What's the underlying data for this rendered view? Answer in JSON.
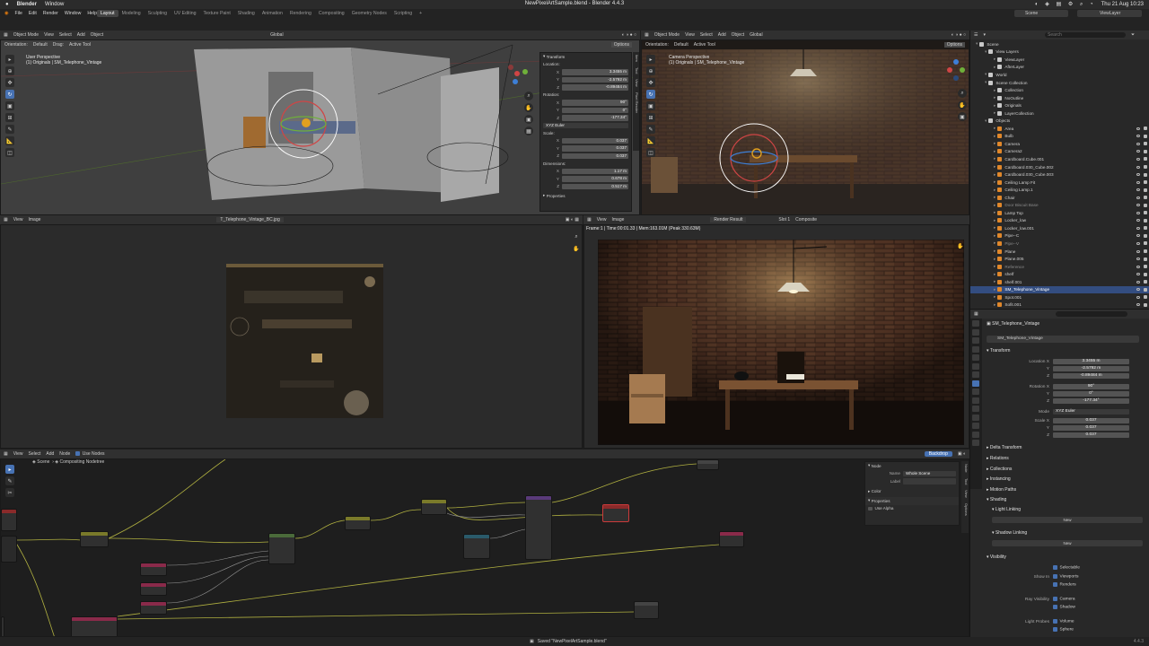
{
  "macbar": {
    "apple": "",
    "app": "Blender",
    "window": "Window",
    "title": "NewPixelArtSample.blend - Blender 4.4.3",
    "datetime": "Thu 21 Aug 10:23"
  },
  "menus": [
    "File",
    "Edit",
    "Render",
    "Window",
    "Help"
  ],
  "workspaces": [
    "Layout",
    "Modeling",
    "Sculpting",
    "UV Editing",
    "Texture Paint",
    "Shading",
    "Animation",
    "Rendering",
    "Compositing",
    "Geometry Nodes",
    "Scripting"
  ],
  "active_workspace": "Layout",
  "scene_field": "Scene",
  "viewlayer_field": "ViewLayer",
  "viewport_left": {
    "mode": "Object Mode",
    "menus": [
      "View",
      "Select",
      "Add",
      "Object"
    ],
    "orientation_label": "Orientation:",
    "orientation": "Default",
    "drag": "Drag:",
    "tool": "Active Tool",
    "pivot": "Global",
    "options": "Options",
    "overlay_line1": "User Perspective",
    "overlay_line2": "(1) Originals | SM_Telephone_Vintage",
    "npanel": {
      "header": "Transform",
      "location_label": "Location:",
      "loc": [
        [
          "X",
          "3.3455 m"
        ],
        [
          "Y",
          "-2.5792 m"
        ],
        [
          "Z",
          "-0.89484 m"
        ]
      ],
      "rotation_label": "Rotation:",
      "rot": [
        [
          "X",
          "90°"
        ],
        [
          "Y",
          "0°"
        ],
        [
          "Z",
          "-177.34°"
        ]
      ],
      "rot_mode": "XYZ Euler",
      "scale_label": "Scale:",
      "scale": [
        [
          "X",
          "0.037"
        ],
        [
          "Y",
          "0.037"
        ],
        [
          "Z",
          "0.037"
        ]
      ],
      "dim_label": "Dimensions:",
      "dim": [
        [
          "X",
          "1.17 m"
        ],
        [
          "Y",
          "0.678 m"
        ],
        [
          "Z",
          "0.517 m"
        ]
      ],
      "properties": "Properties"
    },
    "side_tabs": [
      "Item",
      "Tool",
      "View",
      "Pixel Render"
    ]
  },
  "viewport_right": {
    "mode": "Object Mode",
    "menus": [
      "View",
      "Select",
      "Add",
      "Object"
    ],
    "orientation_label": "Orientation:",
    "orientation": "Default",
    "tool": "Active Tool",
    "pivot": "Global",
    "options": "Options",
    "overlay_line1": "Camera Perspective",
    "overlay_line2": "(1) Originals | SM_Telephone_Vintage"
  },
  "image_editor": {
    "menus": [
      "View",
      "Image"
    ],
    "image_name": "T_Telephone_Vintage_BC.jpg"
  },
  "render_view": {
    "menus": [
      "View",
      "Image"
    ],
    "image_name": "Render Result",
    "slot": "Slot 1",
    "layer": "Composite",
    "frame_info": "Frame:1 | Time:00:01.33 | Mem:163.01M (Peak 330.63M)"
  },
  "node_editor": {
    "menus": [
      "View",
      "Select",
      "Add",
      "Node"
    ],
    "use_nodes": "Use Nodes",
    "breadcrumb_scene": "Scene",
    "breadcrumb_tree": "Compositing Nodetree",
    "backdrop": "Backdrop",
    "side_panel": {
      "tab": "Node",
      "name_label": "Name",
      "name_value": "Whole Scene",
      "label_label": "Label",
      "color": "Color",
      "properties": "Properties",
      "use_alpha": "Use Alpha"
    },
    "side_tabs": [
      "Node",
      "Tool",
      "View",
      "Options"
    ]
  },
  "outliner": {
    "search_placeholder": "Search",
    "items": [
      {
        "name": "Scene",
        "indent": 0,
        "color": "#d0d0d0"
      },
      {
        "name": "View Layers",
        "indent": 1,
        "color": "#d0d0d0"
      },
      {
        "name": "ViewLayer",
        "indent": 2,
        "color": "#d0d0d0"
      },
      {
        "name": "AfterLayer",
        "indent": 2,
        "color": "#d0d0d0"
      },
      {
        "name": "World",
        "indent": 1,
        "color": "#d0d0d0"
      },
      {
        "name": "Scene Collection",
        "indent": 1,
        "color": "#d0d0d0"
      },
      {
        "name": "Collection",
        "indent": 2,
        "color": "#d0d0d0"
      },
      {
        "name": "NoOutline",
        "indent": 2,
        "color": "#d0d0d0"
      },
      {
        "name": "Originals",
        "indent": 2,
        "color": "#d0d0d0"
      },
      {
        "name": "LayerCollection",
        "indent": 2,
        "color": "#d0d0d0"
      },
      {
        "name": "Objects",
        "indent": 1,
        "color": "#d0d0d0"
      },
      {
        "name": "Area",
        "indent": 2,
        "color": "#d0d0d0"
      },
      {
        "name": "Bulb",
        "indent": 2,
        "color": "#d0d0d0"
      },
      {
        "name": "Camera",
        "indent": 2,
        "color": "#d0d0d0"
      },
      {
        "name": "Camera2",
        "indent": 2,
        "color": "#d0d0d0"
      },
      {
        "name": "Cardboard.Cube.001",
        "indent": 2,
        "color": "#d0d0d0"
      },
      {
        "name": "Cardboard.030_Cube.002",
        "indent": 2,
        "color": "#d0d0d0"
      },
      {
        "name": "Cardboard.030_Cube.003",
        "indent": 2,
        "color": "#d0d0d0"
      },
      {
        "name": "Ceiling Lamp Fit",
        "indent": 2,
        "color": "#d0d0d0"
      },
      {
        "name": "Ceiling Lamp.1",
        "indent": 2,
        "color": "#d0d0d0"
      },
      {
        "name": "Chair",
        "indent": 2,
        "color": "#d0d0d0"
      },
      {
        "name": "Door Biscuit Base",
        "indent": 2,
        "color": "#8a8a8a"
      },
      {
        "name": "Lamp Top",
        "indent": 2,
        "color": "#d0d0d0"
      },
      {
        "name": "Locker_low",
        "indent": 2,
        "color": "#d0d0d0"
      },
      {
        "name": "Locker_low.001",
        "indent": 2,
        "color": "#d0d0d0"
      },
      {
        "name": "Pipe--C",
        "indent": 2,
        "color": "#d0d0d0"
      },
      {
        "name": "Pipe--V",
        "indent": 2,
        "color": "#8a8a8a"
      },
      {
        "name": "Plane",
        "indent": 2,
        "color": "#d0d0d0"
      },
      {
        "name": "Plane.005",
        "indent": 2,
        "color": "#d0d0d0"
      },
      {
        "name": "Reference",
        "indent": 2,
        "color": "#8a8a8a"
      },
      {
        "name": "shelf",
        "indent": 2,
        "color": "#d0d0d0"
      },
      {
        "name": "shelf.001",
        "indent": 2,
        "color": "#d0d0d0"
      },
      {
        "name": "SM_Telephone_Vintage",
        "indent": 2,
        "color": "#ffffff",
        "selected": true
      },
      {
        "name": "Spot.001",
        "indent": 2,
        "color": "#d0d0d0"
      },
      {
        "name": "Sofit.001",
        "indent": 2,
        "color": "#d0d0d0"
      }
    ]
  },
  "properties": {
    "object_name": "SM_Telephone_Vintage",
    "object_name2": "SM_Telephone_Vintage",
    "transform": "Transform",
    "location_label": "Location X",
    "loc": [
      "3.3455 m",
      "-2.5792 m",
      "-0.89484 m"
    ],
    "rotation_label": "Rotation X",
    "rot": [
      "90°",
      "0°",
      "-177.34°"
    ],
    "mode_label": "Mode",
    "mode": "XYZ Euler",
    "scale_label": "Scale X",
    "scale": [
      "0.037",
      "0.037",
      "0.037"
    ],
    "y_label": "Y",
    "z_label": "Z",
    "sections": [
      "Delta Transform",
      "Relations",
      "Collections",
      "Instancing",
      "Motion Paths",
      "Shading"
    ],
    "light_linking": "Light Linking",
    "shadow_linking": "Shadow Linking",
    "new": "New",
    "visibility": "Visibility",
    "selectable": "Selectable",
    "show_in": "Show In",
    "viewports": "Viewports",
    "renders": "Renders",
    "ray_visibility": "Ray Visibility",
    "camera": "Camera",
    "shadow": "Shadow",
    "light_probes": "Light Probes",
    "volume": "Volume",
    "sphere": "Sphere"
  },
  "statusbar": {
    "message": "Saved \"NewPixelArtSample.blend\"",
    "version": "4.4.3"
  }
}
